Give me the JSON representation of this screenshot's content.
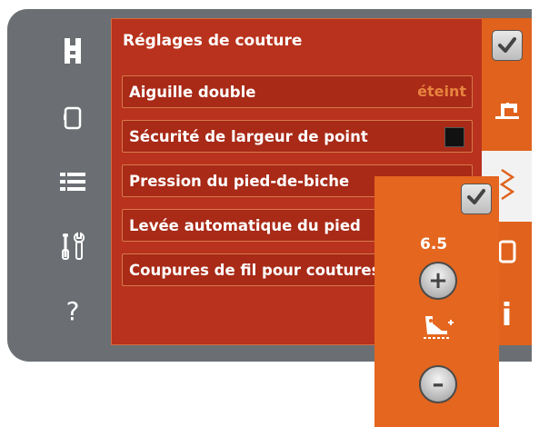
{
  "panel": {
    "title": "Réglages de couture",
    "rows": [
      {
        "label": "Aiguille double",
        "value": "éteint"
      },
      {
        "label": "Sécurité de largeur de point"
      },
      {
        "label": "Pression du pied-de-biche"
      },
      {
        "label": "Levée automatique du pied"
      },
      {
        "label": "Coupures de fil pour coutures"
      }
    ]
  },
  "sidebar": {
    "items": [
      {
        "icon": "presser-foot-icon"
      },
      {
        "icon": "device-icon"
      },
      {
        "icon": "list-icon"
      },
      {
        "icon": "tools-icon"
      },
      {
        "icon": "help-icon",
        "glyph": "?"
      }
    ]
  },
  "right_tabs": [
    {
      "icon": "checkmark-icon"
    },
    {
      "icon": "sewing-machine-icon"
    },
    {
      "icon": "zigzag-stitch-icon"
    },
    {
      "icon": "screen-icon"
    },
    {
      "icon": "info-icon",
      "glyph": "i"
    }
  ],
  "popup": {
    "value": "6.5",
    "plus_glyph": "+",
    "minus_glyph": "–",
    "icon": "presser-foot-pressure-icon"
  },
  "colors": {
    "frame": "#6b6f73",
    "panel": "#b8321d",
    "accent": "#e0621c",
    "value_text": "#e8833f"
  }
}
